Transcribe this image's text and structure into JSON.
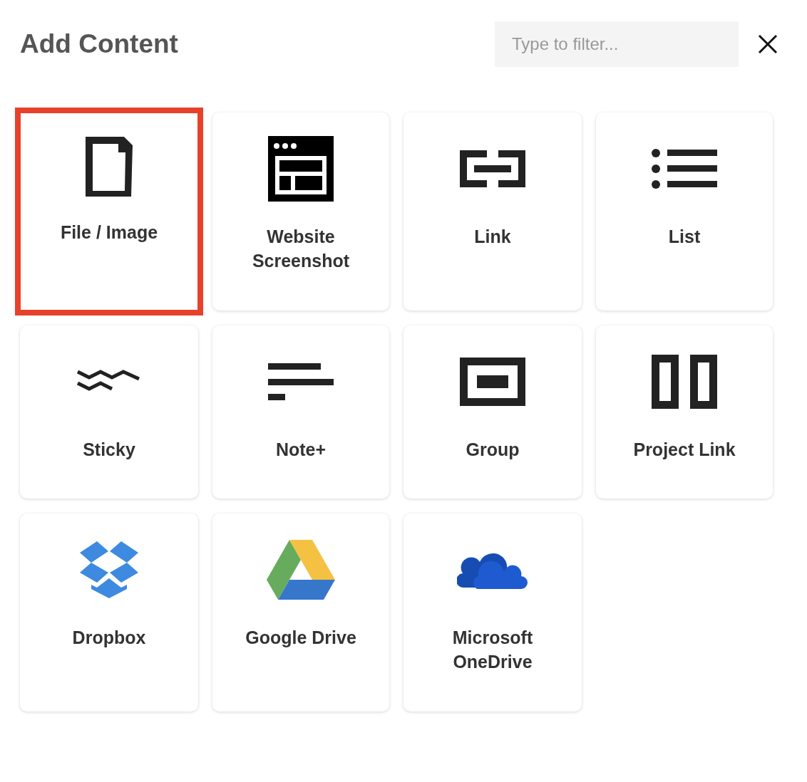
{
  "title": "Add Content",
  "filter": {
    "placeholder": "Type to filter..."
  },
  "items": [
    {
      "kind": "file",
      "label": "File / Image",
      "selected": true
    },
    {
      "kind": "screenshot",
      "label": "Website Screenshot",
      "selected": false
    },
    {
      "kind": "link",
      "label": "Link",
      "selected": false
    },
    {
      "kind": "list",
      "label": "List",
      "selected": false
    },
    {
      "kind": "sticky",
      "label": "Sticky",
      "selected": false
    },
    {
      "kind": "note",
      "label": "Note+",
      "selected": false
    },
    {
      "kind": "group",
      "label": "Group",
      "selected": false
    },
    {
      "kind": "project",
      "label": "Project Link",
      "selected": false
    },
    {
      "kind": "dropbox",
      "label": "Dropbox",
      "selected": false
    },
    {
      "kind": "drive",
      "label": "Google Drive",
      "selected": false
    },
    {
      "kind": "onedrive",
      "label": "Microsoft OneDrive",
      "selected": false
    }
  ]
}
